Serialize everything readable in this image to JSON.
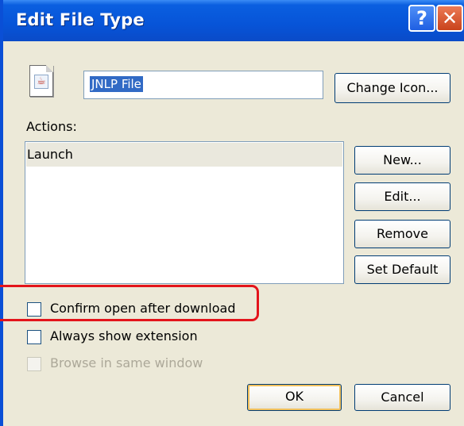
{
  "window": {
    "title": "Edit File Type",
    "help_glyph": "?",
    "close_glyph": "✕"
  },
  "file": {
    "icon": "java-file-icon",
    "name": "JNLP File",
    "change_icon_label": "Change Icon..."
  },
  "actions": {
    "label": "Actions:",
    "items": [
      "Launch"
    ],
    "buttons": {
      "new": "New...",
      "edit": "Edit...",
      "remove": "Remove",
      "set_default": "Set Default"
    }
  },
  "options": [
    {
      "label": "Confirm open after download",
      "checked": false,
      "enabled": true
    },
    {
      "label": "Always show extension",
      "checked": false,
      "enabled": true
    },
    {
      "label": "Browse in same window",
      "checked": false,
      "enabled": false
    }
  ],
  "footer": {
    "ok": "OK",
    "cancel": "Cancel"
  },
  "colors": {
    "titlebar": "#0754d8",
    "dialog_bg": "#ece9d8",
    "selection": "#316ac5",
    "highlight_annotation": "#e3141b"
  }
}
